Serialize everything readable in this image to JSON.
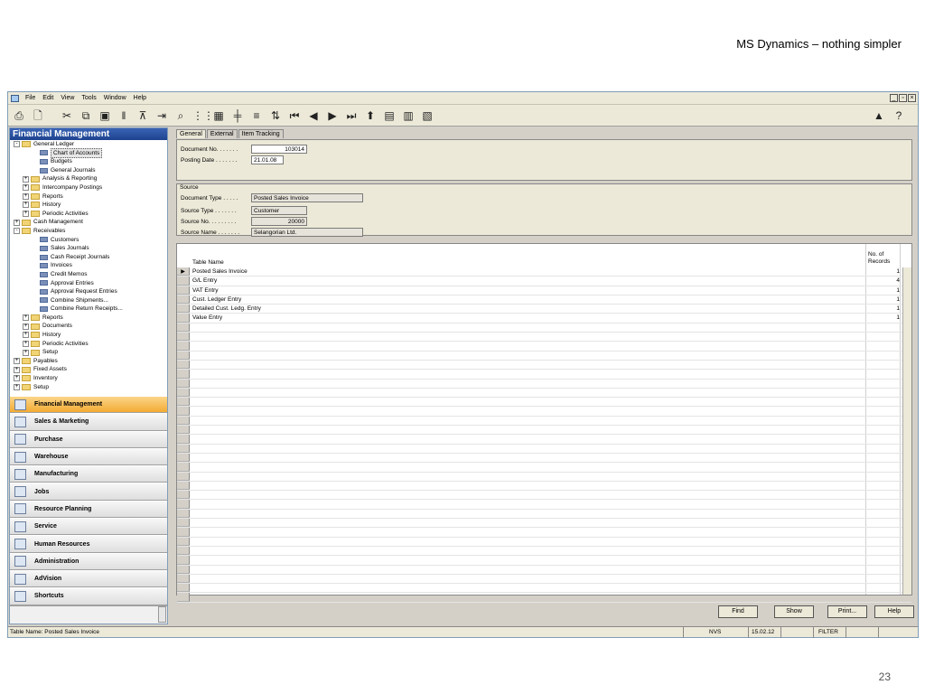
{
  "slide": {
    "title": "MS Dynamics – nothing simpler",
    "page_number": "23"
  },
  "menubar": {
    "items": [
      "File",
      "Edit",
      "View",
      "Tools",
      "Window",
      "Help"
    ]
  },
  "toolbar": {
    "icons": [
      "print-icon",
      "print-preview-icon",
      "cut-icon",
      "copy-icon",
      "paste-icon",
      "attach-icon",
      "filter-icon",
      "flow-icon",
      "find-icon",
      "list-icon",
      "grid-icon",
      "columns-icon",
      "lines-icon",
      "sort-icon",
      "first-icon",
      "prev-icon",
      "next-icon",
      "last-icon",
      "up-icon",
      "matrix-icon",
      "chart-icon",
      "report-icon",
      "analysis-icon",
      "help-icon"
    ]
  },
  "nav": {
    "title": "Financial Management",
    "tree": [
      {
        "label": "General Ledger",
        "level": 0,
        "type": "folder",
        "exp": "−"
      },
      {
        "label": "Chart of Accounts",
        "level": 2,
        "type": "doc",
        "selected": true
      },
      {
        "label": "Budgets",
        "level": 2,
        "type": "doc"
      },
      {
        "label": "General Journals",
        "level": 2,
        "type": "doc"
      },
      {
        "label": "Analysis & Reporting",
        "level": 1,
        "type": "folder",
        "exp": "+"
      },
      {
        "label": "Intercompany Postings",
        "level": 1,
        "type": "folder",
        "exp": "+"
      },
      {
        "label": "Reports",
        "level": 1,
        "type": "folder",
        "exp": "+"
      },
      {
        "label": "History",
        "level": 1,
        "type": "folder",
        "exp": "+"
      },
      {
        "label": "Periodic Activities",
        "level": 1,
        "type": "folder",
        "exp": "+"
      },
      {
        "label": "Cash Management",
        "level": 0,
        "type": "folder",
        "exp": "+"
      },
      {
        "label": "Receivables",
        "level": 0,
        "type": "folder",
        "exp": "−"
      },
      {
        "label": "Customers",
        "level": 2,
        "type": "doc"
      },
      {
        "label": "Sales Journals",
        "level": 2,
        "type": "doc"
      },
      {
        "label": "Cash Receipt Journals",
        "level": 2,
        "type": "doc"
      },
      {
        "label": "Invoices",
        "level": 2,
        "type": "doc"
      },
      {
        "label": "Credit Memos",
        "level": 2,
        "type": "doc"
      },
      {
        "label": "Approval Entries",
        "level": 2,
        "type": "doc"
      },
      {
        "label": "Approval Request Entries",
        "level": 2,
        "type": "doc"
      },
      {
        "label": "Combine Shipments...",
        "level": 2,
        "type": "doc"
      },
      {
        "label": "Combine Return Receipts...",
        "level": 2,
        "type": "doc"
      },
      {
        "label": "Reports",
        "level": 1,
        "type": "folder",
        "exp": "+"
      },
      {
        "label": "Documents",
        "level": 1,
        "type": "folder",
        "exp": "+"
      },
      {
        "label": "History",
        "level": 1,
        "type": "folder",
        "exp": "+"
      },
      {
        "label": "Periodic Activities",
        "level": 1,
        "type": "folder",
        "exp": "+"
      },
      {
        "label": "Setup",
        "level": 1,
        "type": "folder",
        "exp": "+"
      },
      {
        "label": "Payables",
        "level": 0,
        "type": "folder",
        "exp": "+"
      },
      {
        "label": "Fixed Assets",
        "level": 0,
        "type": "folder",
        "exp": "+"
      },
      {
        "label": "Inventory",
        "level": 0,
        "type": "folder",
        "exp": "+"
      },
      {
        "label": "Setup",
        "level": 0,
        "type": "folder",
        "exp": "+"
      }
    ],
    "modules": [
      {
        "label": "Financial Management",
        "active": true
      },
      {
        "label": "Sales & Marketing"
      },
      {
        "label": "Purchase"
      },
      {
        "label": "Warehouse"
      },
      {
        "label": "Manufacturing"
      },
      {
        "label": "Jobs"
      },
      {
        "label": "Resource Planning"
      },
      {
        "label": "Service"
      },
      {
        "label": "Human Resources"
      },
      {
        "label": "Administration"
      },
      {
        "label": "AdVision"
      },
      {
        "label": "Shortcuts"
      }
    ]
  },
  "tabs": [
    "General",
    "External",
    "Item Tracking"
  ],
  "general": {
    "doc_no_label": "Document No. . . . . . .",
    "doc_no": "103014",
    "posting_date_label": "Posting Date . . . . . . .",
    "posting_date": "21.01.08"
  },
  "source": {
    "title": "Source",
    "doc_type_label": "Document Type . . . . .",
    "doc_type": "Posted Sales Invoice",
    "src_type_label": "Source Type . . . . . . .",
    "src_type": "Customer",
    "src_no_label": "Source No. . . . . . . . .",
    "src_no": "20000",
    "src_name_label": "Source Name . . . . . . .",
    "src_name": "Selangorian Ltd."
  },
  "table": {
    "col_name": "Table Name",
    "col_records_1": "No. of",
    "col_records_2": "Records",
    "rows": [
      {
        "name": "Posted Sales Invoice",
        "records": "1",
        "current": true
      },
      {
        "name": "G/L Entry",
        "records": "4"
      },
      {
        "name": "VAT Entry",
        "records": "1"
      },
      {
        "name": "Cust. Ledger Entry",
        "records": "1"
      },
      {
        "name": "Detailed Cust. Ledg. Entry",
        "records": "1"
      },
      {
        "name": "Value Entry",
        "records": "1"
      }
    ],
    "empty_rows": 30
  },
  "buttons": {
    "find": "Find",
    "show": "Show",
    "print": "Print...",
    "help": "Help"
  },
  "statusbar": {
    "text": "Table Name: Posted Sales Invoice",
    "company": "NVS",
    "date": "15.02.12",
    "filter": "FILTER"
  }
}
